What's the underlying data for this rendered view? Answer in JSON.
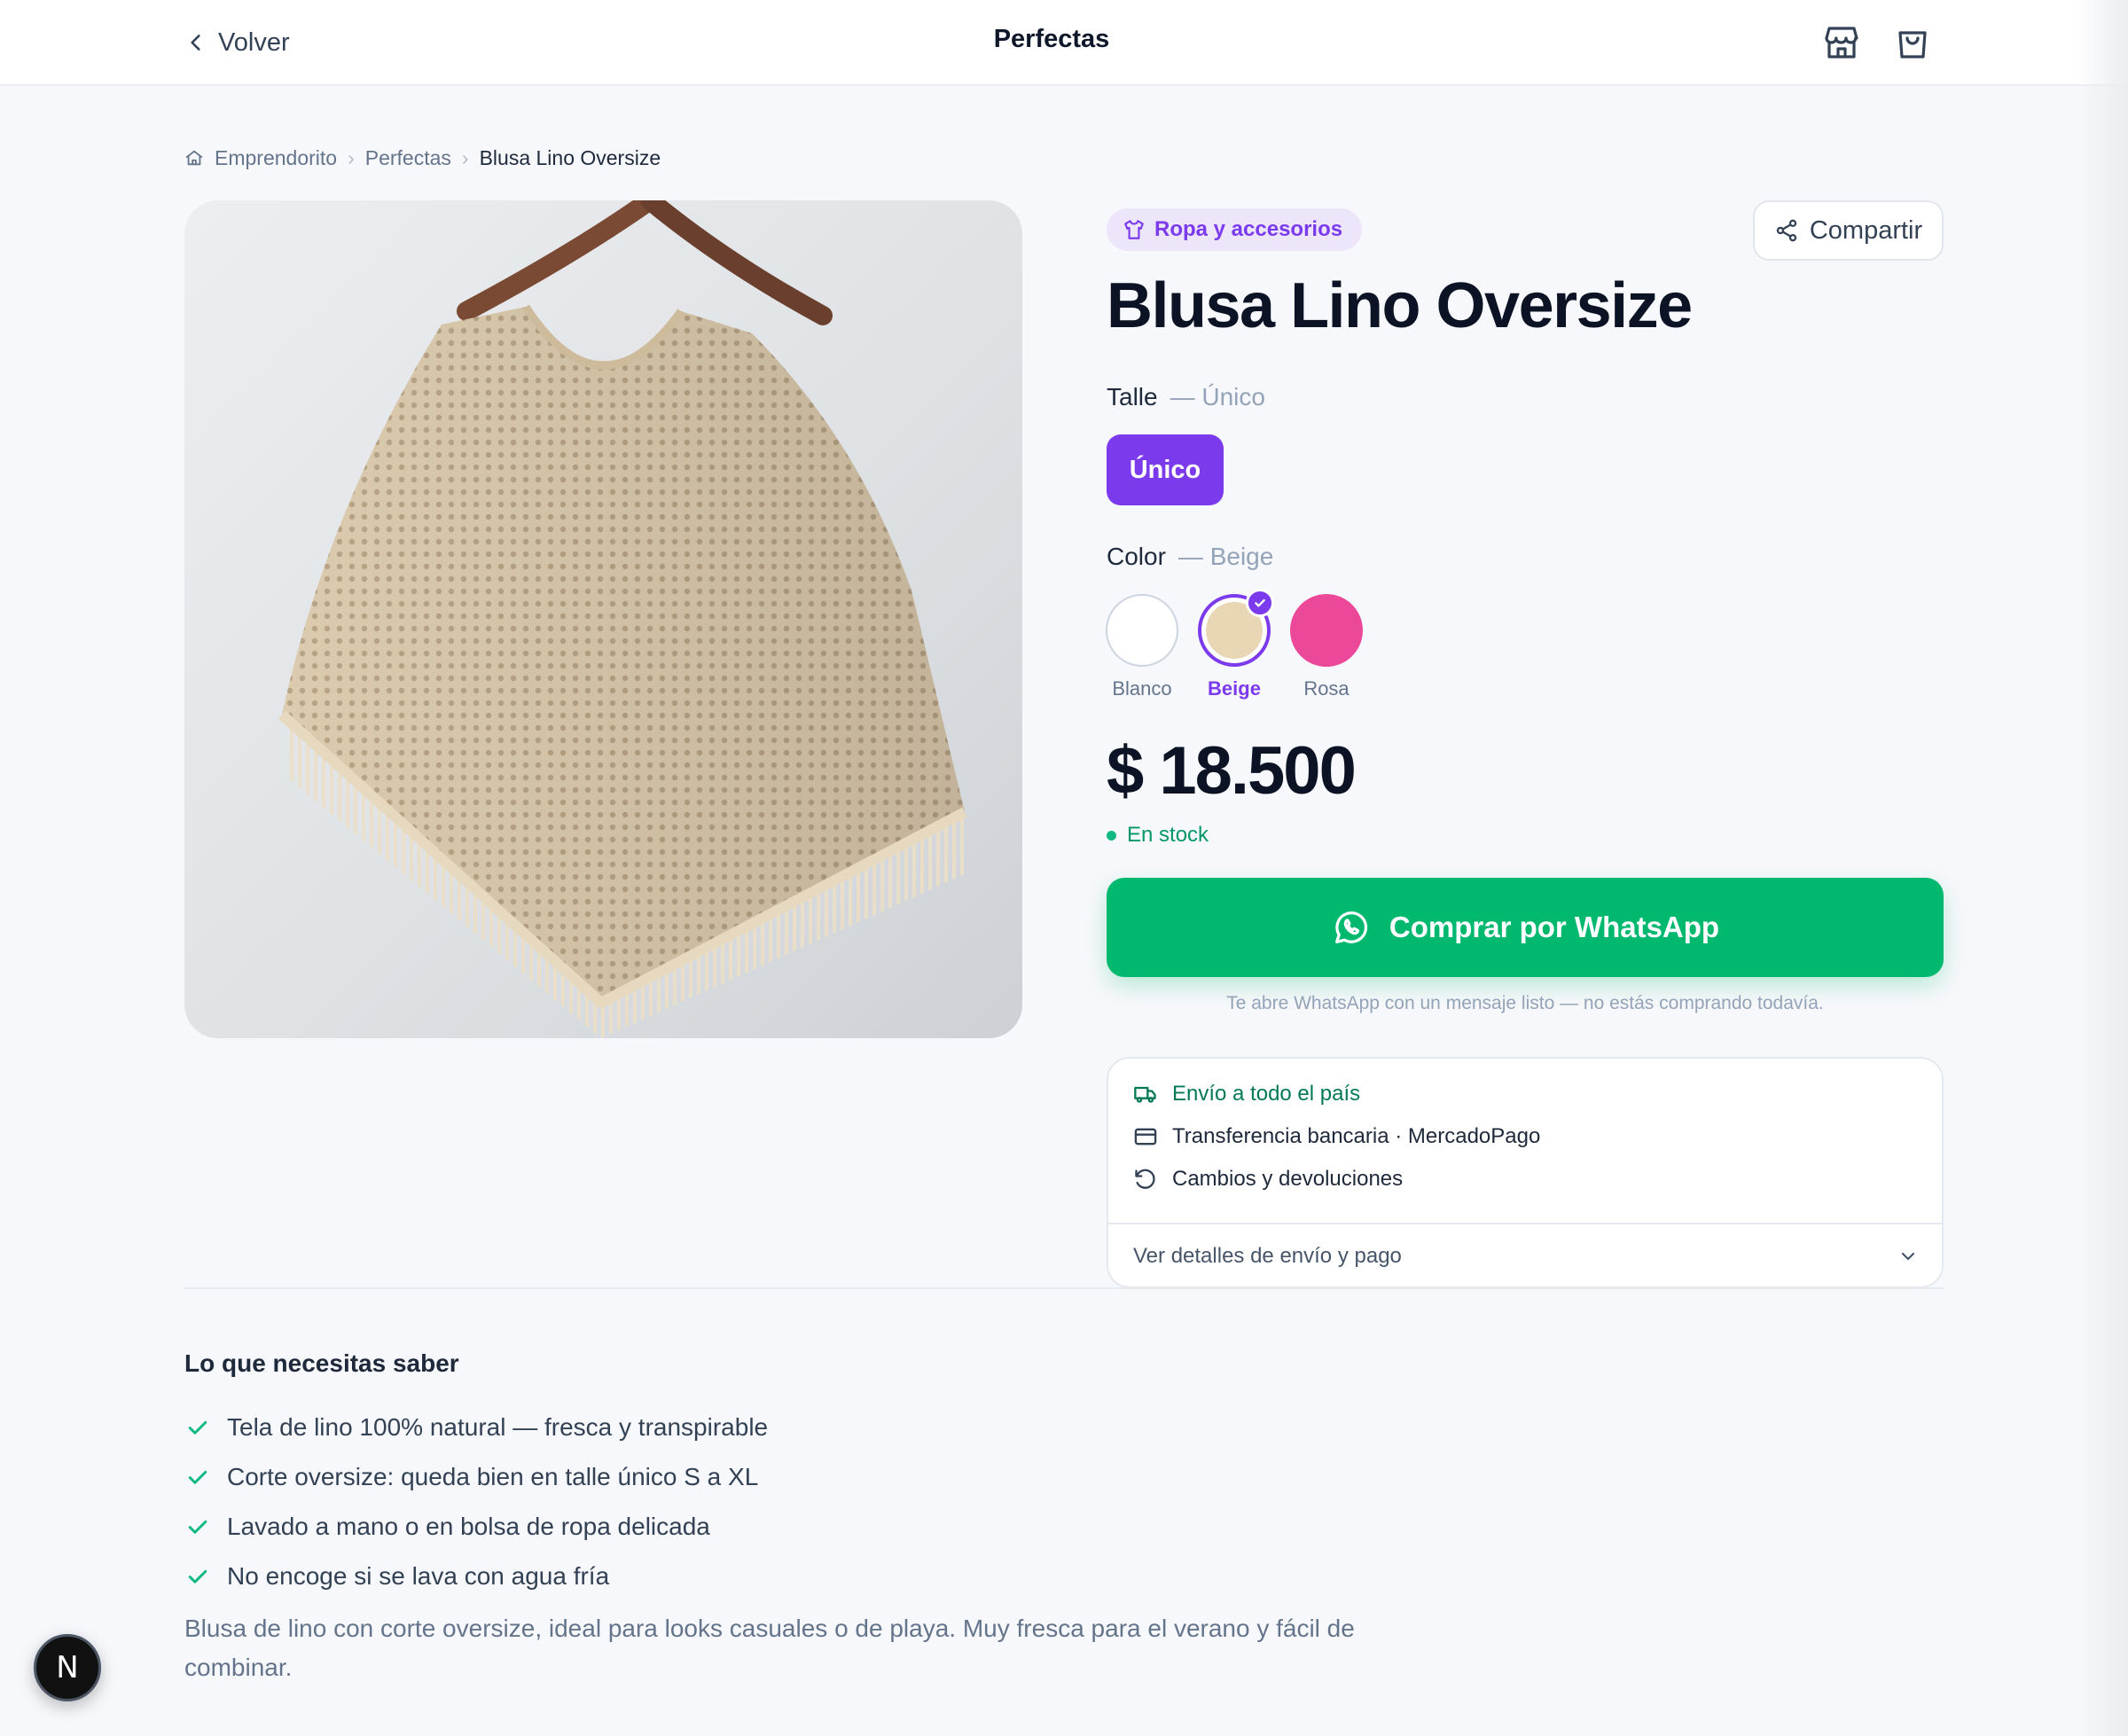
{
  "header": {
    "back_label": "Volver",
    "store_name": "Perfectas"
  },
  "breadcrumb": [
    "Emprendorito",
    "Perfectas",
    "Blusa Lino Oversize"
  ],
  "product": {
    "category": "Ropa y accesorios",
    "share_label": "Compartir",
    "title": "Blusa Lino Oversize",
    "size": {
      "label": "Talle",
      "selected": "— Único",
      "options": [
        "Único"
      ]
    },
    "color": {
      "label": "Color",
      "selected": "— Beige",
      "options": [
        {
          "name": "Blanco",
          "hex": "#ffffff"
        },
        {
          "name": "Beige",
          "hex": "#e9d6b4"
        },
        {
          "name": "Rosa",
          "hex": "#ec4899"
        }
      ]
    },
    "price": "$ 18.500",
    "stock": "En stock",
    "whatsapp_button": "Comprar por WhatsApp",
    "whatsapp_note": "Te abre WhatsApp con un mensaje listo — no estás comprando todavía."
  },
  "info": {
    "shipping": "Envío a todo el país",
    "payment": "Transferencia bancaria · MercadoPago",
    "returns": "Cambios y devoluciones",
    "details_link": "Ver detalles de envío y pago"
  },
  "know": {
    "title": "Lo que necesitas saber",
    "items": [
      "Tela de lino 100% natural — fresca y transpirable",
      "Corte oversize: queda bien en talle único S a XL",
      "Lavado a mano o en bolsa de ropa delicada",
      "No encoge si se lava con agua fría"
    ],
    "description": "Blusa de lino con corte oversize, ideal para looks casuales o de playa. Muy fresca para el verano y fácil de combinar."
  },
  "dev_badge": "N",
  "colors": {
    "accent": "#7c3aed",
    "whatsapp": "#00b96f",
    "stock": "#059669"
  }
}
